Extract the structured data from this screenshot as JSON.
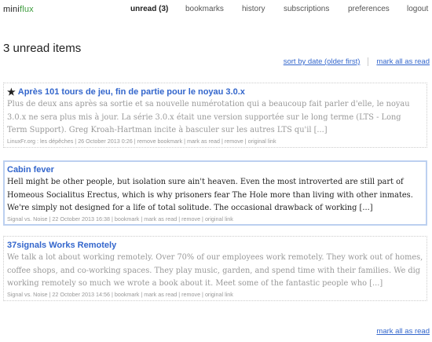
{
  "app": {
    "logo_part1": "mini",
    "logo_part2": "flux"
  },
  "nav": [
    {
      "label": "unread (3)",
      "active": true
    },
    {
      "label": "bookmarks"
    },
    {
      "label": "history"
    },
    {
      "label": "subscriptions"
    },
    {
      "label": "preferences"
    },
    {
      "label": "logout"
    }
  ],
  "page": {
    "title": "3 unread items"
  },
  "toolbar": {
    "sort_label": "sort by date (older first)",
    "mark_all_label": "mark all as read"
  },
  "items": [
    {
      "bookmarked": true,
      "star_icon": "★",
      "title": "Après 101 tours de jeu, fin de partie pour le noyau 3.0.x",
      "content": "Plus de deux ans après sa sortie et sa nouvelle numérotation qui a beaucoup fait parler d'elle, le noyau 3.0.x ne sera plus mis à jour. La série 3.0.x était une version supportée sur le long terme (LTS - Long Term Support). Greg Kroah-Hartman incite à basculer sur les autres LTS qu'il [...]",
      "source": "LinuxFr.org : les dépêches",
      "date": "26 October 2013 0:26",
      "actions": [
        "remove bookmark",
        "mark as read",
        "remove",
        "original link"
      ]
    },
    {
      "bookmarked": false,
      "title": "Cabin fever",
      "content": "Hell might be other people, but isolation sure ain't heaven. Even the most introverted are still part of Homeous Socialitus Erectus, which is why prisoners fear The Hole more than living with other inmates. We're simply not designed for a life of total solitude. The occasional drawback of working [...]",
      "source": "Signal vs. Noise",
      "date": "22 October 2013 16:38",
      "actions": [
        "bookmark",
        "mark as read",
        "remove",
        "original link"
      ]
    },
    {
      "bookmarked": false,
      "title": "37signals Works Remotely",
      "content": "We talk a lot about working remotely. Over 70% of our employees work remotely. They work out of homes, coffee shops, and co-working spaces. They play music, garden, and spend time with their families. We dig working remotely so much we wrote a book about it. Meet some of the fantastic people who [...]",
      "source": "Signal vs. Noise",
      "date": "22 October 2013 14:56",
      "actions": [
        "bookmark",
        "mark as read",
        "remove",
        "original link"
      ]
    }
  ],
  "footer": {
    "mark_all_label": "mark all as read"
  },
  "colors": {
    "link": "#3366cc",
    "logo_accent": "#3c9b3c",
    "selected_border": "#bcd0f0",
    "muted": "#999999"
  }
}
